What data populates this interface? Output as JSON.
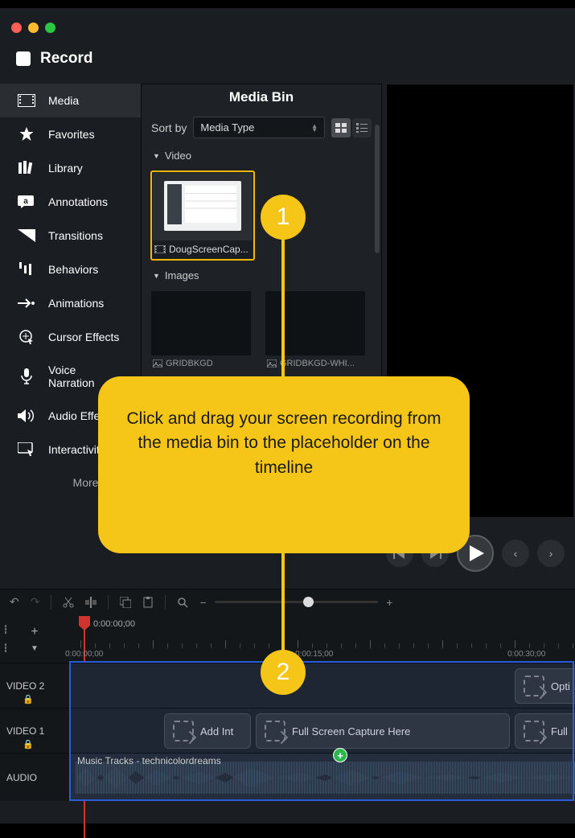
{
  "record_label": "Record",
  "sidebar": {
    "items": [
      {
        "label": "Media"
      },
      {
        "label": "Favorites"
      },
      {
        "label": "Library"
      },
      {
        "label": "Annotations"
      },
      {
        "label": "Transitions"
      },
      {
        "label": "Behaviors"
      },
      {
        "label": "Animations"
      },
      {
        "label": "Cursor Effects"
      },
      {
        "label": "Voice Narration"
      },
      {
        "label": "Audio Effects"
      },
      {
        "label": "Interactivity"
      }
    ],
    "more": "More"
  },
  "media_bin": {
    "title": "Media Bin",
    "sort_label": "Sort by",
    "sort_value": "Media Type",
    "sections": {
      "video": "Video",
      "images": "Images"
    },
    "video_clip": "DougScreenCap...",
    "image1": "GRIDBKGD",
    "image2": "GRIDBKGD-WHI..."
  },
  "timeline": {
    "playhead_time": "0:00:00;00",
    "marks": [
      "0:00:00;00",
      "0:00:15;00",
      "0:00:30;00"
    ],
    "tracks": {
      "video2": "VIDEO 2",
      "video1": "VIDEO 1",
      "audio": "AUDIO"
    },
    "clips": {
      "opti": "Opti",
      "add_int": "Add Int",
      "full_capture": "Full Screen Capture Here",
      "full": "Full"
    },
    "audio_clip": "Music Tracks - technicolordreams"
  },
  "callout": {
    "text": "Click and drag your screen recording from the media bin to the placeholder on the timeline",
    "badge1": "1",
    "badge2": "2"
  }
}
